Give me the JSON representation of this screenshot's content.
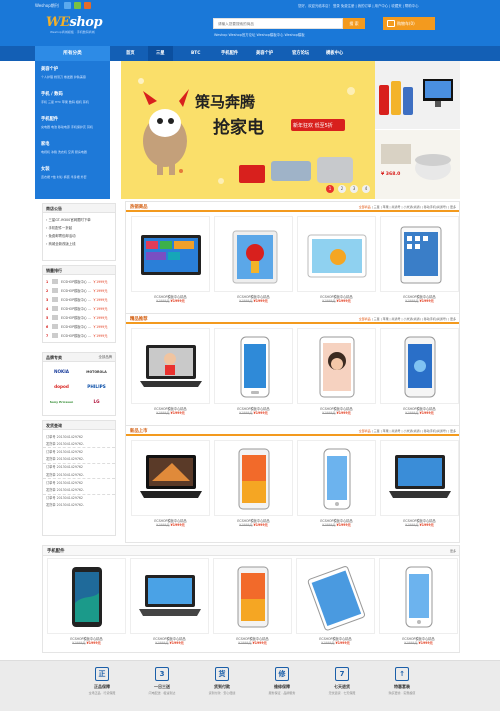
{
  "top": {
    "brand_line": "Weshop期刊",
    "links": "您好，欢迎光临本店！ 登录 免费注册 | 我的订单 | 用户中心 | 收藏夹 | 帮助中心",
    "logo_we": "WE",
    "logo_rest": "shop",
    "logo_sub": "Weshop商城模板 · 手机数码商城",
    "search_placeholder": "请输入您要搜索的商品",
    "search_button": "搜 索",
    "hot_words": "Weshop  Weshop官方论坛  Weshop模板中心  Weshop模板",
    "cart_label": "购物车(0)"
  },
  "nav": {
    "category_label": "所有分类",
    "items": [
      "首页",
      "三星",
      "BTC",
      "手机配件",
      "美容个护",
      "官方论坛",
      "模板中心"
    ]
  },
  "categories": [
    {
      "title": "美容个护",
      "subs": "个人护理  剃须刀  卷发器  护肤美容"
    },
    {
      "title": "手机 / 数码",
      "subs": "手机  三星  HTC  苹果  数码  相机  耳机"
    },
    {
      "title": "手机配件",
      "subs": "充电器  电池  移动电源  手机保护壳  耳机"
    },
    {
      "title": "家电",
      "subs": "电视机  冰箱  洗衣机  空调  厨房电器"
    },
    {
      "title": "女装",
      "subs": "连衣裙  T恤  衬衫  裤装  半身裙  外套"
    }
  ],
  "banner": {
    "headline1": "策马奔腾",
    "headline2": "抢家电",
    "promo_line": "新年狂欢 低至5折",
    "dots": [
      "1",
      "2",
      "3",
      "4"
    ],
    "ad2_price": "¥ 368.0"
  },
  "notice": {
    "title": "商店公告",
    "items": [
      "三星GT-I9300官网限时下单",
      "手机配件一折起",
      "免费邮寄包邮活动",
      "商城全新改版上线"
    ]
  },
  "ranking": {
    "title": "销量排行",
    "items": [
      {
        "num": "1",
        "name": "ECSHOP模板中心 ...",
        "price": "￥1999元"
      },
      {
        "num": "2",
        "name": "ECSHOP模板中心 ...",
        "price": "￥1999元"
      },
      {
        "num": "3",
        "name": "ECSHOP模板中心 ...",
        "price": "￥1999元"
      },
      {
        "num": "4",
        "name": "ECSHOP模板中心 ...",
        "price": "￥1999元"
      },
      {
        "num": "5",
        "name": "ECSHOP模板中心 ...",
        "price": "￥1999元"
      },
      {
        "num": "6",
        "name": "ECSHOP模板中心 ...",
        "price": "￥1999元"
      },
      {
        "num": "7",
        "name": "ECSHOP模板中心 ...",
        "price": "￥1999元"
      }
    ]
  },
  "brands": {
    "title": "品牌专卖",
    "more": "全部品牌",
    "items": [
      {
        "name": "NOKIA",
        "color": "#1a3d9c"
      },
      {
        "name": "MOTOROLA",
        "color": "#333333"
      },
      {
        "name": "dopod",
        "color": "#d8201d"
      },
      {
        "name": "PHILIPS",
        "color": "#0b4fa8"
      },
      {
        "name": "Sony Ericsson",
        "color": "#2f8a2f"
      },
      {
        "name": "LG",
        "color": "#b0123a"
      }
    ]
  },
  "shipping": {
    "title": "发货查询",
    "rows": [
      "订单号  2013041429762",
      "发货单  2013041429762-",
      "订单号  2013041429762",
      "发货单  2013041429762-",
      "订单号  2013041429762",
      "发货单  2013041429762-",
      "订单号  2013041429762",
      "发货单  2013041429762-",
      "订单号  2013041429762",
      "发货单  2013041429762-"
    ]
  },
  "sections": [
    {
      "title": "热销商品",
      "links": [
        "全部商品",
        "三星",
        "苹果",
        "尚通号",
        "小米通(尚通)",
        "移动手机(尚通号)",
        "更多"
      ],
      "products": [
        {
          "name": "ECSHOP模板中心精品",
          "old": "¥1999元",
          "price": "¥1999元"
        },
        {
          "name": "ECSHOP模板中心精品",
          "old": "¥1999元",
          "price": "¥1999元"
        },
        {
          "name": "ECSHOP模板中心精品",
          "old": "¥1999元",
          "price": "¥1999元"
        },
        {
          "name": "ECSHOP模板中心精品",
          "old": "¥1999元",
          "price": "¥1999元"
        }
      ]
    },
    {
      "title": "精品推荐",
      "links": [
        "全部商品",
        "三星",
        "苹果",
        "尚通号",
        "小米通(尚通)",
        "移动手机(尚通号)",
        "更多"
      ],
      "products": [
        {
          "name": "ECSHOP模板中心精品",
          "old": "¥1999元",
          "price": "¥1999元"
        },
        {
          "name": "ECSHOP模板中心精品",
          "old": "¥1999元",
          "price": "¥1999元"
        },
        {
          "name": "ECSHOP模板中心精品",
          "old": "¥1999元",
          "price": "¥1999元"
        },
        {
          "name": "ECSHOP模板中心精品",
          "old": "¥1999元",
          "price": "¥1999元"
        }
      ]
    },
    {
      "title": "新品上市",
      "links": [
        "全部商品",
        "三星",
        "苹果",
        "尚通号",
        "小米通(尚通)",
        "移动手机(尚通号)",
        "更多"
      ],
      "products": [
        {
          "name": "ECSHOP模板中心精品",
          "old": "¥1999元",
          "price": "¥1999元"
        },
        {
          "name": "ECSHOP模板中心精品",
          "old": "¥1999元",
          "price": "¥1999元"
        },
        {
          "name": "ECSHOP模板中心精品",
          "old": "¥1999元",
          "price": "¥1999元"
        },
        {
          "name": "ECSHOP模板中心精品",
          "old": "¥1999元",
          "price": "¥1999元"
        }
      ]
    }
  ],
  "accessories": {
    "title": "手机配件",
    "more": "更多",
    "products": [
      {
        "name": "ECSHOP模板中心精品",
        "old": "¥1999元",
        "price": "¥1999元"
      },
      {
        "name": "ECSHOP模板中心精品",
        "old": "¥1999元",
        "price": "¥1999元"
      },
      {
        "name": "ECSHOP模板中心精品",
        "old": "¥1999元",
        "price": "¥1999元"
      },
      {
        "name": "ECSHOP模板中心精品",
        "old": "¥1999元",
        "price": "¥1999元"
      },
      {
        "name": "ECSHOP模板中心精品",
        "old": "¥1999元",
        "price": "¥1999元"
      }
    ]
  },
  "footer": [
    {
      "icon": "正",
      "title": "正品保障",
      "sub": "全场正品 · 行货保障"
    },
    {
      "icon": "3",
      "title": "一日三送",
      "sub": "闪电配送 · 极速到达"
    },
    {
      "icon": "货",
      "title": "货到付款",
      "sub": "货到付款 · 安心便捷"
    },
    {
      "icon": "修",
      "title": "维修保障",
      "sub": "服务保证 · 品牌服务"
    },
    {
      "icon": "7",
      "title": "七天退货",
      "sub": "无忧退货 · 七天保障"
    },
    {
      "icon": "↑",
      "title": "特惠套装",
      "sub": "购买更省 · 实惠超值"
    }
  ]
}
